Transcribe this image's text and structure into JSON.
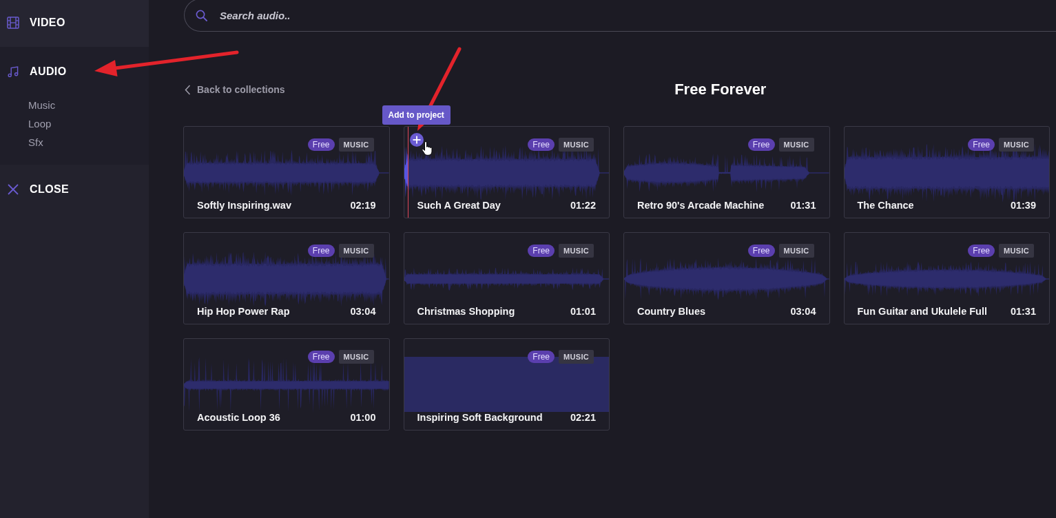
{
  "sidebar": {
    "items": [
      {
        "label": "VIDEO",
        "selected": false
      },
      {
        "label": "AUDIO",
        "selected": true,
        "children": [
          {
            "label": "Music"
          },
          {
            "label": "Loop"
          },
          {
            "label": "Sfx"
          }
        ]
      }
    ],
    "close": "CLOSE"
  },
  "search": {
    "placeholder": "Search audio.."
  },
  "back_link": "Back to collections",
  "title": "Free Forever",
  "cards": [
    {
      "title": "Softly Inspiring.wav",
      "duration": "02:19",
      "price": "Free",
      "category": "MUSIC",
      "kind": "wave",
      "hovered": false
    },
    {
      "title": "Such A Great Day",
      "duration": "01:22",
      "price": "Free",
      "category": "MUSIC",
      "kind": "wave",
      "hovered": true,
      "tooltip": "Add to project",
      "level": 0.02
    },
    {
      "title": "Retro 90's Arcade Machine",
      "duration": "01:31",
      "price": "Free",
      "category": "MUSIC",
      "kind": "wave",
      "hovered": false
    },
    {
      "title": "The Chance",
      "duration": "01:39",
      "price": "Free",
      "category": "MUSIC",
      "kind": "wave",
      "hovered": false
    },
    {
      "title": "Hip Hop Power Rap",
      "duration": "03:04",
      "price": "Free",
      "category": "MUSIC",
      "kind": "wave",
      "hovered": false
    },
    {
      "title": "Christmas Shopping",
      "duration": "01:01",
      "price": "Free",
      "category": "MUSIC",
      "kind": "wave",
      "hovered": false
    },
    {
      "title": "Country Blues",
      "duration": "03:04",
      "price": "Free",
      "category": "MUSIC",
      "kind": "wave",
      "hovered": false
    },
    {
      "title": "Fun Guitar and Ukulele Full",
      "duration": "01:31",
      "price": "Free",
      "category": "MUSIC",
      "kind": "wave",
      "hovered": false
    },
    {
      "title": "Acoustic Loop 36",
      "duration": "01:00",
      "price": "Free",
      "category": "MUSIC",
      "kind": "wave",
      "hovered": false
    },
    {
      "title": "Inspiring Soft Background",
      "duration": "02:21",
      "price": "Free",
      "category": "MUSIC",
      "kind": "block",
      "hovered": false
    }
  ]
}
